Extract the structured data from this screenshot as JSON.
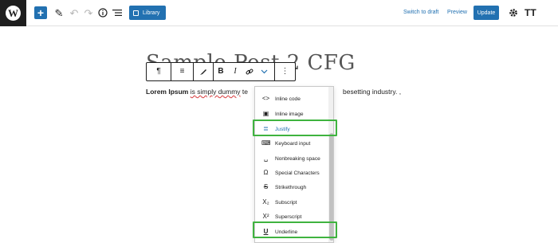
{
  "topbar": {
    "logo_letter": "W",
    "add_symbol": "+",
    "library_label": "Library",
    "switch_draft_label": "Switch to draft",
    "preview_label": "Preview",
    "update_label": "Update",
    "typography_label": "TT"
  },
  "editor": {
    "title": "Sample Post 2 CFG",
    "paragraph_bold": "Lorem Ipsum",
    "paragraph_underlined": "is simply dummy",
    "paragraph_rest": " te",
    "paragraph_tail": "besetting industry. ,"
  },
  "block_toolbar": {
    "paragraph_icon": "¶",
    "align_icon": "≡",
    "bold": "B",
    "italic": "I",
    "link_icon": "⛓",
    "more_icon": "⋮"
  },
  "format_menu": {
    "items": [
      {
        "label": "Inline code",
        "icon": "<>"
      },
      {
        "label": "Inline image",
        "icon": "▣"
      },
      {
        "label": "Justify",
        "icon": "≣"
      },
      {
        "label": "Keyboard input",
        "icon": "⌨"
      },
      {
        "label": "Nonbreaking space",
        "icon": "␣"
      },
      {
        "label": "Special Characters",
        "icon": "Ω"
      },
      {
        "label": "Strikethrough",
        "icon": "S"
      },
      {
        "label": "Subscript",
        "icon": "X₂"
      },
      {
        "label": "Superscript",
        "icon": "X²"
      },
      {
        "label": "Underline",
        "icon": "U"
      }
    ]
  },
  "highlight_color": "#3fb33f",
  "accent_color": "#2271b1"
}
